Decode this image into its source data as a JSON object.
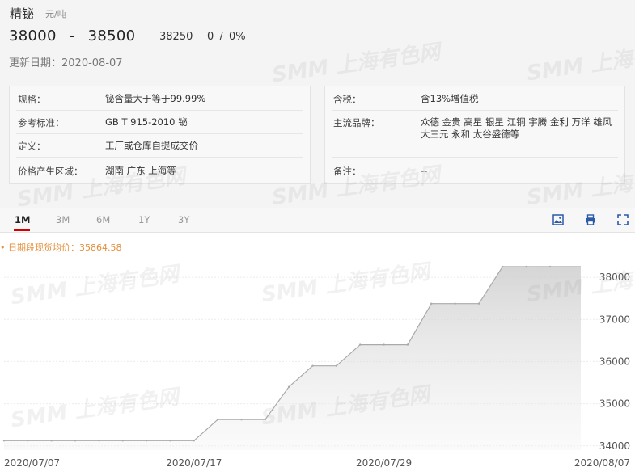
{
  "product": {
    "name": "精铋",
    "unit": "元/吨"
  },
  "price": {
    "range_low": "38000",
    "range_sep": "-",
    "range_high": "38500",
    "average": "38250",
    "change": "0",
    "change_sep": "/",
    "change_pct": "0%"
  },
  "update": {
    "label": "更新日期：",
    "date": "2020-08-07"
  },
  "info_left": [
    {
      "key": "规格：",
      "value": "铋含量大于等于99.99%"
    },
    {
      "key": "参考标准：",
      "value": "GB T 915-2010 铋"
    },
    {
      "key": "定义：",
      "value": "工厂或仓库自提成交价"
    },
    {
      "key": "价格产生区域：",
      "value": "湖南 广东 上海等"
    }
  ],
  "info_right": [
    {
      "key": "含税：",
      "value": "含13%增值税"
    },
    {
      "key": "主流品牌：",
      "value": "众德 金贵 高星 银星 江铜 宇腾 金利 万洋 雄风 大三元 永和 太谷盛德等"
    },
    {
      "key": "备注：",
      "value": "--"
    }
  ],
  "tabs": [
    {
      "label": "1M",
      "active": true
    },
    {
      "label": "3M",
      "active": false
    },
    {
      "label": "6M",
      "active": false
    },
    {
      "label": "1Y",
      "active": false
    },
    {
      "label": "3Y",
      "active": false
    }
  ],
  "toolbar": {
    "icons": [
      "image-download-icon",
      "print-icon",
      "fullscreen-icon"
    ]
  },
  "avg_note": {
    "bullet": "•",
    "label": "日期段现货均价：",
    "value": "35864.58"
  },
  "watermark": "SMM 上海有色网",
  "colors": {
    "accent": "#d40000",
    "note": "#e38f3b",
    "line": "#aaaaaa"
  },
  "chart_data": {
    "type": "area",
    "x": [
      "2020/07/07",
      "2020/07/08",
      "2020/07/09",
      "2020/07/10",
      "2020/07/13",
      "2020/07/14",
      "2020/07/15",
      "2020/07/16",
      "2020/07/17",
      "2020/07/20",
      "2020/07/21",
      "2020/07/22",
      "2020/07/23",
      "2020/07/24",
      "2020/07/27",
      "2020/07/28",
      "2020/07/29",
      "2020/07/30",
      "2020/07/31",
      "2020/08/03",
      "2020/08/04",
      "2020/08/05",
      "2020/08/06",
      "2020/08/07"
    ],
    "series": [
      {
        "values": [
          34125,
          34125,
          34125,
          34125,
          34125,
          34125,
          34125,
          34125,
          34125,
          34625,
          34625,
          34625,
          35400,
          35900,
          35900,
          36400,
          36400,
          36400,
          37375,
          37375,
          37375,
          38250,
          38250,
          38250
        ]
      }
    ],
    "xticks": [
      "2020/07/07",
      "2020/07/17",
      "2020/07/29",
      "2020/08/07"
    ],
    "yticks": [
      34000,
      35000,
      36000,
      37000,
      38000
    ],
    "ylim": [
      33900,
      38500
    ],
    "grid": true
  }
}
